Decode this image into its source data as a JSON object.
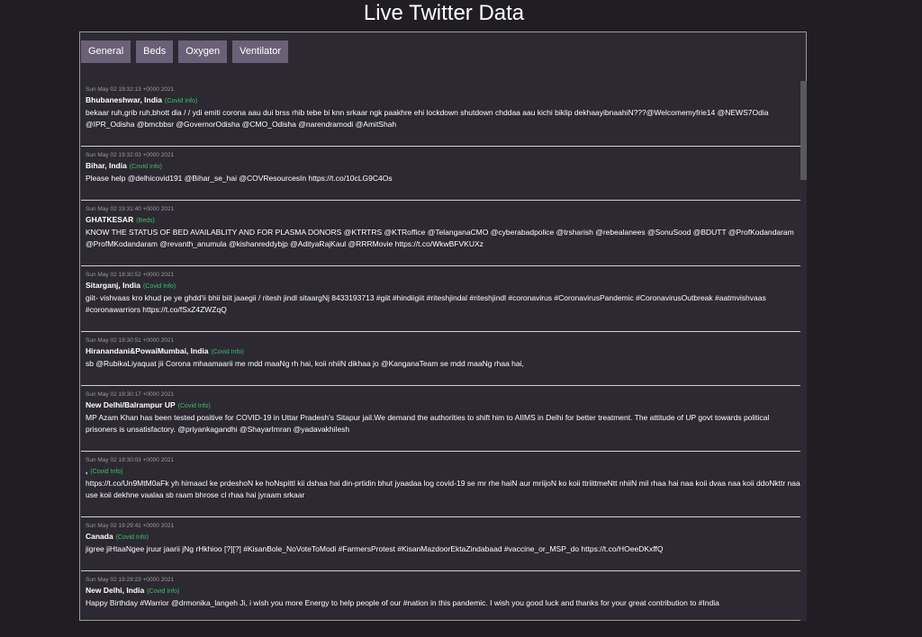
{
  "page": {
    "title": "Live Twitter Data"
  },
  "tabs": [
    "General",
    "Beds",
    "Oxygen",
    "Ventilator"
  ],
  "tweets": [
    {
      "timestamp": "Sun May 02 19:32:13 +0000 2021",
      "location": "Bhubaneshwar, India",
      "tag": "(Covid Info)",
      "text": "bekaar ruh,grib ruh,bhott dia / / ydi emiti corona aau dui brss rhib tebe bi knn srkaar ngk paakhre ehi lockdown shutdown chddaa aau kichi biklip dekhaayibnaahiN???@Welcomemyfrie14 @NEWS7Odia @IPR_Odisha @bmcbbsr @GovernorOdisha @CMO_Odisha @narendramodi @AmitShah"
    },
    {
      "timestamp": "Sun May 02 19:32:03 +0000 2021",
      "location": "Bihar, India",
      "tag": "(Covid Info)",
      "text": "Please help @delhicovid191 @Bihar_se_hai @COVResourcesIn https://t.co/10cLG9C4Os"
    },
    {
      "timestamp": "Sun May 02 19:31:40 +0000 2021",
      "location": "GHATKESAR",
      "tag": "(Beds)",
      "text": "KNOW THE STATUS OF BED AVAILABLITY AND FOR PLASMA DONORS @KTRTRS @KTRoffice @TelanganaCMO @cyberabadpolice @trsharish @rebealanees @SonuSood @BDUTT @ProfKodandaram @ProfMKodandaram @revanth_anumula @kishanreddybjp @AdityaRajKaul @RRRMovie https://t.co/WkwBFVKUXz"
    },
    {
      "timestamp": "Sun May 02 19:30:52 +0000 2021",
      "location": "Sitarganj, India",
      "tag": "(Covid Info)",
      "text": "giit- vishvaas kro khud pe ye ghdd'ii bhii biit jaaegii / ritesh jindl sitaargNj 8433193713 #giit #hindiigiit #riteshjindal #riteshjindl #coronavirus #CoronavirusPandemic #CoronavirusOutbreak #aatmvishvaas #coronawarriors https://t.co/fSxZ4ZWZqQ"
    },
    {
      "timestamp": "Sun May 02 19:30:51 +0000 2021",
      "location": "Hiranandani&PowaiMumbai, India",
      "tag": "(Covid Info)",
      "text": "sb @RubikaLiyaquat jii Corona mhaamaarii me mdd maaNg rh hai, koii nhiiN dikhaa jo @KanganaTeam se mdd maaNg rhaa hai,"
    },
    {
      "timestamp": "Sun May 02 19:30:17 +0000 2021",
      "location": "New Delhi/Balrampur UP",
      "tag": "(Covid Info)",
      "text": "MP Azam Khan has been tested positive for COVID-19 in Uttar Pradesh's Sitapur jail.We demand the authorities to shift him to AIIMS in Delhi for better treatment. The attitude of UP govt towards political prisoners is unsatisfactory. @priyankagandhi @ShayarImran @yadavakhilesh"
    },
    {
      "timestamp": "Sun May 02 19:30:03 +0000 2021",
      "location": ",",
      "tag": "(Covid Info)",
      "text": "https://t.co/Un9MtM0aFk yh himaacl ke prdeshoN ke hoNspittl kii dshaa hai din-prtidin bhut jyaadaa log covid-19 se mr rhe haiN aur mriijoN ko koii ttriittmeNtt nhiiN mil rhaa hai naa koii dvaa naa koii ddoNkttr naa use koii dekhne vaalaa sb raam bhrose cl rhaa hai jyraam srkaar"
    },
    {
      "timestamp": "Sun May 02 19:29:41 +0000 2021",
      "location": "Canada",
      "tag": "(Covid Info)",
      "text": "jigree jiHtaaNgee jruur jaarii jNg rHkhioo [?][?] #KisanBole_NoVoteToModi #FarmersProtest #KisanMazdoorEktaZindabaad #vaccine_or_MSP_do https://t.co/HOeeDKxffQ"
    },
    {
      "timestamp": "Sun May 02 19:29:23 +0000 2021",
      "location": "New Delhi, India",
      "tag": "(Covid Info)",
      "text": "Happy Birthday #Warrior @drmonika_langeh Ji, i wish you more Energy to help people of our #nation in this pandemic. I wish you good luck and thanks for your great contribution to #India"
    }
  ]
}
